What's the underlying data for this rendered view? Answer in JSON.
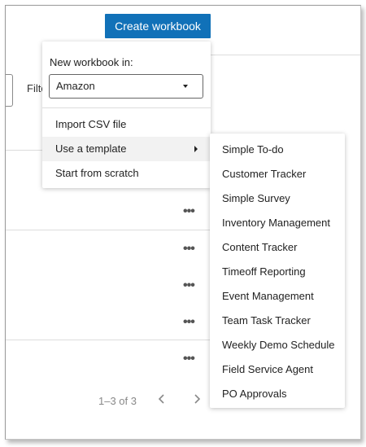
{
  "toolbar": {
    "create_label": "Create workbook"
  },
  "filter": {
    "label": "Filter"
  },
  "menu": {
    "new_in_label": "New workbook in:",
    "selected_account": "Amazon",
    "items": [
      {
        "label": "Import CSV file"
      },
      {
        "label": "Use a template"
      },
      {
        "label": "Start from scratch"
      }
    ]
  },
  "templates": [
    {
      "label": "Simple To-do"
    },
    {
      "label": "Customer Tracker"
    },
    {
      "label": "Simple Survey"
    },
    {
      "label": "Inventory Management"
    },
    {
      "label": "Content Tracker"
    },
    {
      "label": "Timeoff Reporting"
    },
    {
      "label": "Event Management"
    },
    {
      "label": "Team Task Tracker"
    },
    {
      "label": "Weekly Demo Schedule"
    },
    {
      "label": "Field Service Agent"
    },
    {
      "label": "PO Approvals"
    }
  ],
  "row_actions": [
    {
      "label": "•••"
    },
    {
      "label": "•••"
    },
    {
      "label": "•••"
    },
    {
      "label": "•••"
    },
    {
      "label": "•••"
    }
  ],
  "pagination": {
    "text": "1–3 of 3"
  },
  "icons": {
    "prev": "chevron-left-icon",
    "next": "chevron-right-icon",
    "submenu": "caret-right-icon",
    "dropdown": "caret-down-icon"
  },
  "colors": {
    "primary": "#1171b8"
  }
}
